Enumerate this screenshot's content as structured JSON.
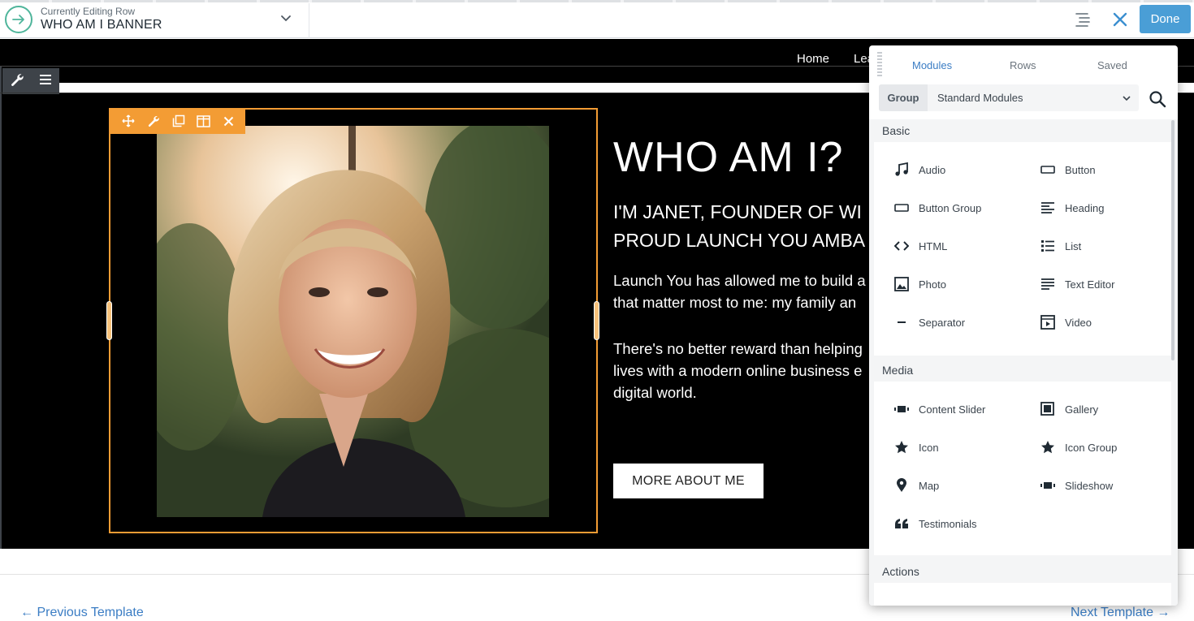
{
  "topbar": {
    "editing_label": "Currently Editing Row",
    "editing_title": "WHO AM I BANNER",
    "done_label": "Done"
  },
  "site": {
    "nav": [
      "Home",
      "Lea"
    ]
  },
  "hero": {
    "title": "WHO AM I?",
    "subtitle_line1": "I'M JANET, FOUNDER OF WI",
    "subtitle_line2": "PROUD LAUNCH YOU AMBA",
    "p1_line1": "Launch You has allowed me to build a",
    "p1_line2": "that matter most to me: my family an",
    "p2_line1": "There's no better reward than helping",
    "p2_line2": "lives with a modern online business e",
    "p2_line3": "digital world.",
    "button_label": "MORE ABOUT ME"
  },
  "footer": {
    "prev": "← Previous Template",
    "next": "Next Template →"
  },
  "panel": {
    "tabs": [
      "Modules",
      "Rows",
      "Saved"
    ],
    "active_tab": "Modules",
    "group_label": "Group",
    "group_value": "Standard Modules",
    "sections": {
      "basic": {
        "title": "Basic",
        "modules": [
          {
            "label": "Audio",
            "icon": "music-note-icon"
          },
          {
            "label": "Button",
            "icon": "button-icon"
          },
          {
            "label": "Button Group",
            "icon": "button-group-icon"
          },
          {
            "label": "Heading",
            "icon": "heading-icon"
          },
          {
            "label": "HTML",
            "icon": "code-icon"
          },
          {
            "label": "List",
            "icon": "list-icon"
          },
          {
            "label": "Photo",
            "icon": "photo-icon"
          },
          {
            "label": "Text Editor",
            "icon": "text-editor-icon"
          },
          {
            "label": "Separator",
            "icon": "separator-icon"
          },
          {
            "label": "Video",
            "icon": "video-icon"
          }
        ]
      },
      "media": {
        "title": "Media",
        "modules": [
          {
            "label": "Content Slider",
            "icon": "content-slider-icon"
          },
          {
            "label": "Gallery",
            "icon": "gallery-icon"
          },
          {
            "label": "Icon",
            "icon": "star-icon"
          },
          {
            "label": "Icon Group",
            "icon": "star-icon"
          },
          {
            "label": "Map",
            "icon": "map-pin-icon"
          },
          {
            "label": "Slideshow",
            "icon": "slideshow-icon"
          },
          {
            "label": "Testimonials",
            "icon": "quote-icon"
          }
        ]
      },
      "actions": {
        "title": "Actions"
      }
    }
  },
  "colors": {
    "accent_blue": "#4a9ed6",
    "link_blue": "#3b7dc4",
    "column_highlight": "#f39c34",
    "row_icon_green": "#4fb59b"
  }
}
